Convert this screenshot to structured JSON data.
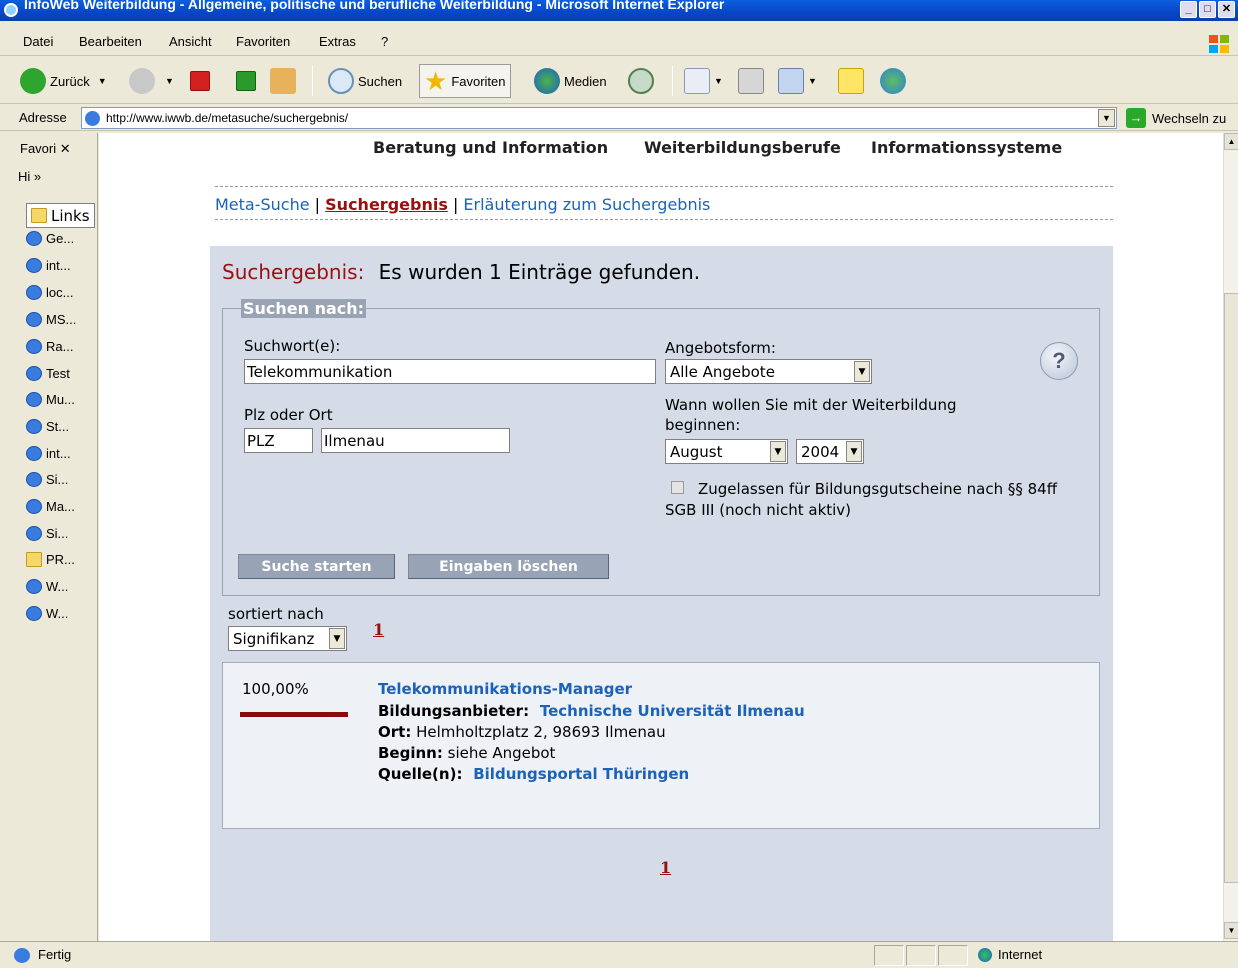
{
  "window": {
    "title": "InfoWeb Weiterbildung - Allgemeine, politische und berufliche Weiterbildung - Microsoft Internet Explorer",
    "ctrls": [
      "_",
      "□",
      "✕"
    ]
  },
  "menu": [
    "Datei",
    "Bearbeiten",
    "Ansicht",
    "Favoriten",
    "Extras",
    "?"
  ],
  "toolbar": {
    "back": "Zurück",
    "search": "Suchen",
    "favorites": "Favoriten",
    "media": "Medien"
  },
  "address": {
    "label": "Adresse",
    "url": "http://www.iwwb.de/metasuche/suchergebnis/",
    "go": "Wechseln zu"
  },
  "favorites": {
    "header": "Favori ✕",
    "history": "Hi »",
    "items": [
      "Links",
      "Ge...",
      "int...",
      "loc...",
      "MS...",
      "Ra...",
      "Test",
      "Mu...",
      "St...",
      "int...",
      "Si...",
      "Ma...",
      "Si...",
      "PR...",
      "W...",
      "W..."
    ]
  },
  "page": {
    "topnav": [
      "Beratung und Information",
      "Weiterbildungsberufe",
      "Informationssysteme"
    ],
    "crumbs": {
      "meta": "Meta-Suche",
      "sep": "|",
      "current": "Suchergebnis",
      "explain": "Erläuterung zum Suchergebnis"
    },
    "result_label": "Suchergebnis:",
    "result_text": "Es wurden 1 Einträge gefunden.",
    "form": {
      "legend": "Suchen nach:",
      "keyword_label": "Suchwort(e):",
      "keyword_value": "Telekommunikation",
      "plz_label": "Plz oder Ort",
      "plz_value": "PLZ",
      "ort_value": "Ilmenau",
      "angebot_label": "Angebotsform:",
      "angebot_value": "Alle Angebote",
      "wann_label": "Wann wollen Sie mit der Weiterbildung beginnen:",
      "month_value": "August",
      "year_value": "2004",
      "gutschein_label": "Zugelassen für Bildungsgutscheine nach §§ 84ff SGB III (noch nicht aktiv)",
      "help": "?",
      "search_btn": "Suche starten",
      "clear_btn": "Eingaben löschen"
    },
    "sort_label": "sortiert nach",
    "sort_value": "Signifikanz",
    "page_num": "1",
    "result": {
      "score": "100,00%",
      "score_fraction": 1.0,
      "title": "Telekommunikations-Manager",
      "provider_label": "Bildungsanbieter:",
      "provider": "Technische Universität Ilmenau",
      "ort_label": "Ort:",
      "ort": "Helmholtzplatz 2, 98693 Ilmenau",
      "beginn_label": "Beginn:",
      "beginn": "siehe Angebot",
      "quelle_label": "Quelle(n):",
      "quelle": "Bildungsportal Thüringen"
    }
  },
  "status": {
    "text": "Fertig",
    "zone": "Internet"
  },
  "colors": {
    "accent_red": "#9a1010",
    "link_blue": "#1a63b8",
    "panel_bg": "#d5dce8"
  }
}
